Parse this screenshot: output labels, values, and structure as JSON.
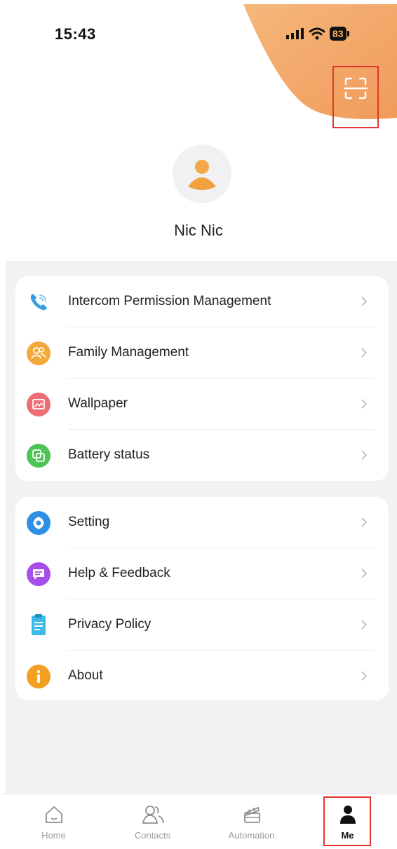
{
  "status_bar": {
    "time": "15:43",
    "battery": "83"
  },
  "header": {
    "scan_icon": "scan-icon"
  },
  "profile": {
    "name": "Nic  Nic",
    "avatar_icon": "person-icon"
  },
  "menu_group_1": [
    {
      "label": "Intercom Permission Management",
      "icon": "phone-icon",
      "color": "#3a9de3"
    },
    {
      "label": "Family Management",
      "icon": "family-icon",
      "color": "#f2a93b"
    },
    {
      "label": "Wallpaper",
      "icon": "wallpaper-icon",
      "color": "#ec6d72"
    },
    {
      "label": "Battery status",
      "icon": "battery-status-icon",
      "color": "#4fc456"
    }
  ],
  "menu_group_2": [
    {
      "label": "Setting",
      "icon": "gear-icon",
      "color": "#2f8fe4"
    },
    {
      "label": "Help & Feedback",
      "icon": "feedback-icon",
      "color": "#a84ee8"
    },
    {
      "label": "Privacy Policy",
      "icon": "document-icon",
      "color": "#3dbbe8"
    },
    {
      "label": "About",
      "icon": "info-icon",
      "color": "#f3a022"
    }
  ],
  "tabbar": {
    "home": "Home",
    "contacts": "Contacts",
    "automation": "Automation",
    "me": "Me",
    "active": "Me"
  },
  "colors": {
    "accent_orange": "#f1a261",
    "highlight_red": "#e3342f",
    "background": "#f2f2f5"
  }
}
